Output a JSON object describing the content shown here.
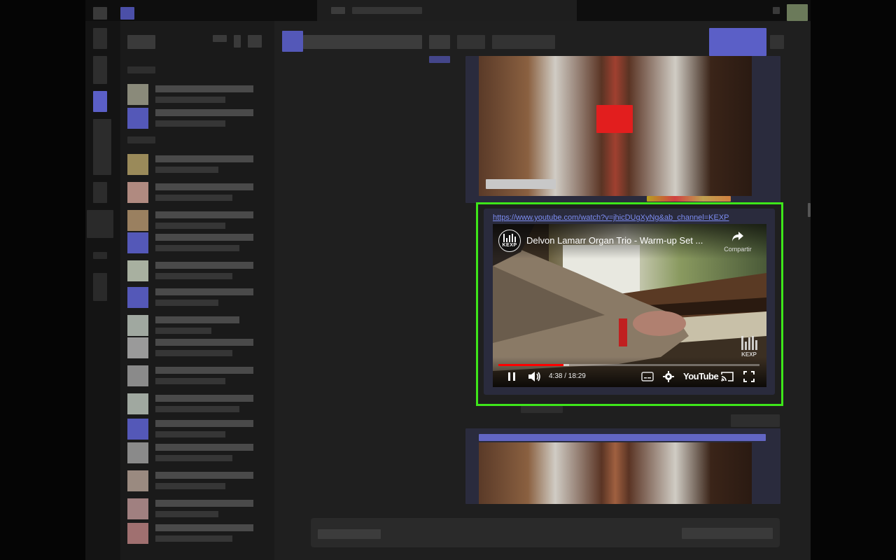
{
  "embed": {
    "url": "https://www.youtube.com/watch?v=jhicDUgXyNg&ab_channel=KEXP",
    "channel_logo_text": "KEXP",
    "video_title": "Delvon Lamarr Organ Trio - Warm-up Set ...",
    "share_label": "Compartir",
    "watermark_text": "KEXP",
    "time_display": "4:38 / 18:29",
    "brand_label": "YouTube",
    "playback_progress": 0.25,
    "buffered_progress": 0.27
  },
  "icons": {
    "pause": "pause-icon",
    "volume": "volume-icon",
    "subtitles": "subtitles-icon",
    "settings": "gear-icon",
    "cast": "cast-icon",
    "fullscreen": "fullscreen-icon",
    "share": "share-icon"
  },
  "colors": {
    "accent": "#5b5fc7",
    "highlight_outline": "#3ee61a",
    "progress": "#ff0000",
    "link": "#7c8cf0"
  }
}
